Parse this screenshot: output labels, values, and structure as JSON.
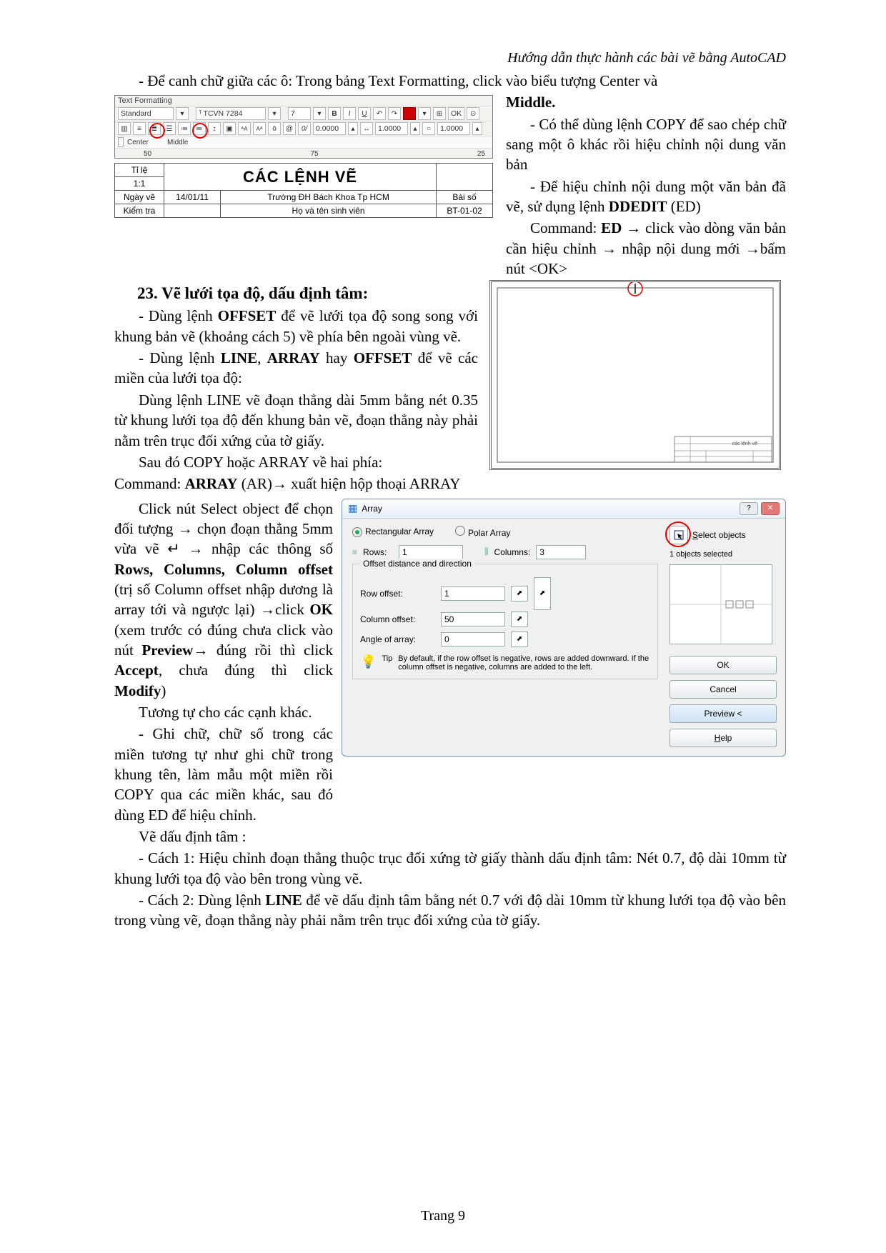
{
  "header": "Hướng dẫn thực hành các bài vẽ bằng AutoCAD",
  "p1": "-     Để canh chữ giữa các ô: Trong bảng Text Formatting, click vào biểu tượng Center và",
  "p_middle": "Middle.",
  "p2a": "-   Có thể dùng lệnh COPY để sao chép chữ sang một ô khác rồi hiệu chỉnh nội dung văn bản",
  "p2b": "-   Để hiệu chỉnh nội dung một văn bản đã vẽ, sử dụng lệnh ",
  "ddedit": "DDEDIT",
  "ed": " (ED)",
  "p2c_pre": "Command: ",
  "p2c_cmd": "ED",
  "p2c_post": " → click vào dòng văn bản cần hiệu chỉnh → nhập nội dung mới →bấm nút <OK>",
  "heading23": "23. Vẽ lưới tọa độ, dấu định tâm:",
  "p3a": "-    Dùng lệnh ",
  "offset": "OFFSET",
  "p3a2": " để vẽ lưới tọa độ song song với khung bản vẽ (khoảng cách 5) về phía bên ngoài vùng vẽ.",
  "p3b1": "-    Dùng   lệnh   ",
  "line": "LINE",
  "p3b2": ",   ",
  "array": "ARRAY",
  "p3b3": "   hay ",
  "p3b4": " để vẽ các miền của lưới tọa độ:",
  "p3c": "Dùng lệnh LINE vẽ đoạn thẳng dài 5mm bằng nét 0.35 từ khung lưới tọa độ đến khung bản vẽ, đoạn thẳng này phải nằm trên trục đối xứng của tờ giấy.",
  "p3d": "Sau đó COPY hoặc ARRAY về hai phía:",
  "p3e_pre": "Command: ",
  "p3e_cmd": "ARRAY",
  "p3e_post": " (AR)→   xuất hiện hộp thoại ARRAY",
  "p4a": "Click nút Select object để chọn đối tượng → chọn đoạn thẳng 5mm vừa vẽ ↵ → nhập các thông số ",
  "p4a_b": "Rows, Columns, Column offset",
  "p4a2": " (trị số Column offset nhập dương là array tới và ngược lại) →click ",
  "ok": "OK",
  "p4a3": " (xem trước có đúng chưa click vào nút ",
  "preview": "Preview",
  "p4a4": "→ đúng rồi thì click ",
  "accept": "Accept",
  "p4a5": ", chưa đúng thì click ",
  "modify": "Modify",
  "p4a6": ")",
  "p4b": "Tương tự cho các cạnh khác.",
  "p4c": "-   Ghi chữ, chữ số trong các miền tương tự như ghi chữ trong khung tên, làm mẫu một miền rồi COPY qua các miền khác, sau đó dùng ED để hiệu chỉnh.",
  "p4d": "Vẽ dấu định tâm :",
  "p5a": "-    Cách 1: Hiệu chỉnh đoạn thẳng thuộc trục đối xứng tờ giấy thành dấu định tâm: Nét 0.7, độ dài 10mm từ khung lưới tọa độ vào bên trong vùng vẽ.",
  "p5b": "-    Cách 2: Dùng lệnh ",
  "p5b2": " để vẽ dấu định tâm bằng nét 0.7 với độ dài 10mm từ khung lưới tọa độ vào bên trong vùng vẽ, đoạn thẳng này phải nằm trên trục đối xứng của tờ giấy.",
  "footer": "Trang 9",
  "toolbar": {
    "title": "Text Formatting",
    "style": "Standard",
    "font": "TCVN 7284",
    "size": "7",
    "b": "B",
    "i": "I",
    "u": "U",
    "ok": "OK",
    "center": "Center",
    "middle": "Middle",
    "n1": "0.0000",
    "n2": "1.0000",
    "n3": "1.0000",
    "r1": "50",
    "r2": "75",
    "r3": "25"
  },
  "titleblock": {
    "h_big": "CÁC LỆNH VẼ",
    "r1c1": "Tỉ lệ",
    "r2c1": "1:1",
    "r3c1": "Ngày vẽ",
    "r3c2": "14/01/11",
    "r3c3": "Trường ĐH Bách Khoa Tp HCM",
    "r3c4": "Bài số",
    "r4c1": "Kiểm tra",
    "r4c3": "Họ và tên sinh viên",
    "r4c4": "BT-01-02"
  },
  "tinytb": {
    "title": "các lệnh vẽ"
  },
  "dlg": {
    "title": "Array",
    "rect": "Rectangular Array",
    "polar": "Polar Array",
    "select": "Select objects",
    "selected": "1 objects selected",
    "rows": "Rows:",
    "rows_v": "1",
    "cols": "Columns:",
    "cols_v": "3",
    "section": "Offset distance and direction",
    "row_off": "Row offset:",
    "row_off_v": "1",
    "col_off": "Column offset:",
    "col_off_v": "50",
    "angle": "Angle of array:",
    "angle_v": "0",
    "tip_lbl": "Tip",
    "tip": "By default, if the row offset is negative, rows are added downward. If the column offset is negative, columns are added to the left.",
    "btn_ok": "OK",
    "btn_cancel": "Cancel",
    "btn_preview": "Preview <",
    "btn_help": "Help"
  }
}
